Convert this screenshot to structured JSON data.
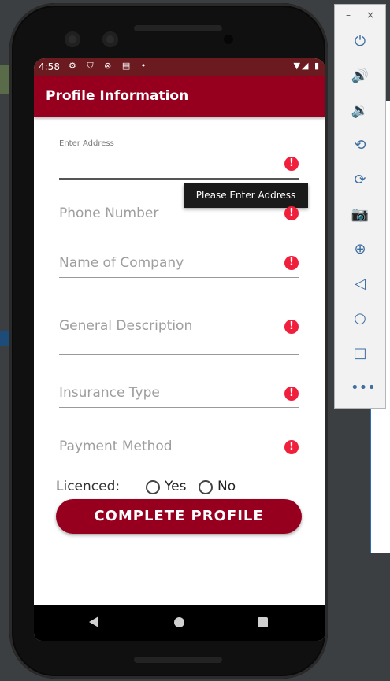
{
  "status_bar": {
    "time": "4:58"
  },
  "app_bar": {
    "title": "Profile Information"
  },
  "form": {
    "address": {
      "floating_label": "Enter Address",
      "value": ""
    },
    "error_tooltip": "Please Enter Address",
    "phone": {
      "placeholder": "Phone Number"
    },
    "company": {
      "placeholder": "Name of Company"
    },
    "description": {
      "placeholder": "General Description"
    },
    "insurance": {
      "placeholder": "Insurance Type"
    },
    "payment": {
      "placeholder": "Payment Method"
    },
    "licenced": {
      "label": "Licenced:",
      "options": [
        "Yes",
        "No"
      ]
    },
    "submit_label": "COMPLETE   PROFILE"
  },
  "emulator_panel": {
    "window_controls": [
      "–",
      "×"
    ],
    "buttons": [
      "power-icon",
      "volume-up-icon",
      "volume-down-icon",
      "rotate-left-icon",
      "rotate-right-icon",
      "camera-icon",
      "zoom-icon",
      "back-icon",
      "home-icon",
      "overview-icon",
      "more-icon"
    ]
  },
  "colors": {
    "primary": "#96001e",
    "error": "#f0203c",
    "status_bar": "#6b1b20"
  }
}
